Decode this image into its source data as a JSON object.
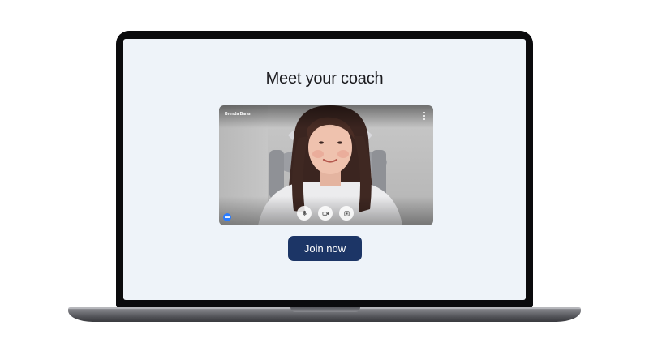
{
  "page": {
    "title": "Meet your coach"
  },
  "video": {
    "participant_name": "Brenda Baran",
    "icons": {
      "more": "more-vertical-icon",
      "mic": "microphone-icon",
      "camera": "camera-icon",
      "effects": "visual-effects-icon",
      "menu": "more-options-icon"
    }
  },
  "actions": {
    "join_label": "Join now"
  },
  "colors": {
    "screen_background": "#eef3f9",
    "join_button": "#1c3566",
    "effects_button": "#2a7cff"
  }
}
